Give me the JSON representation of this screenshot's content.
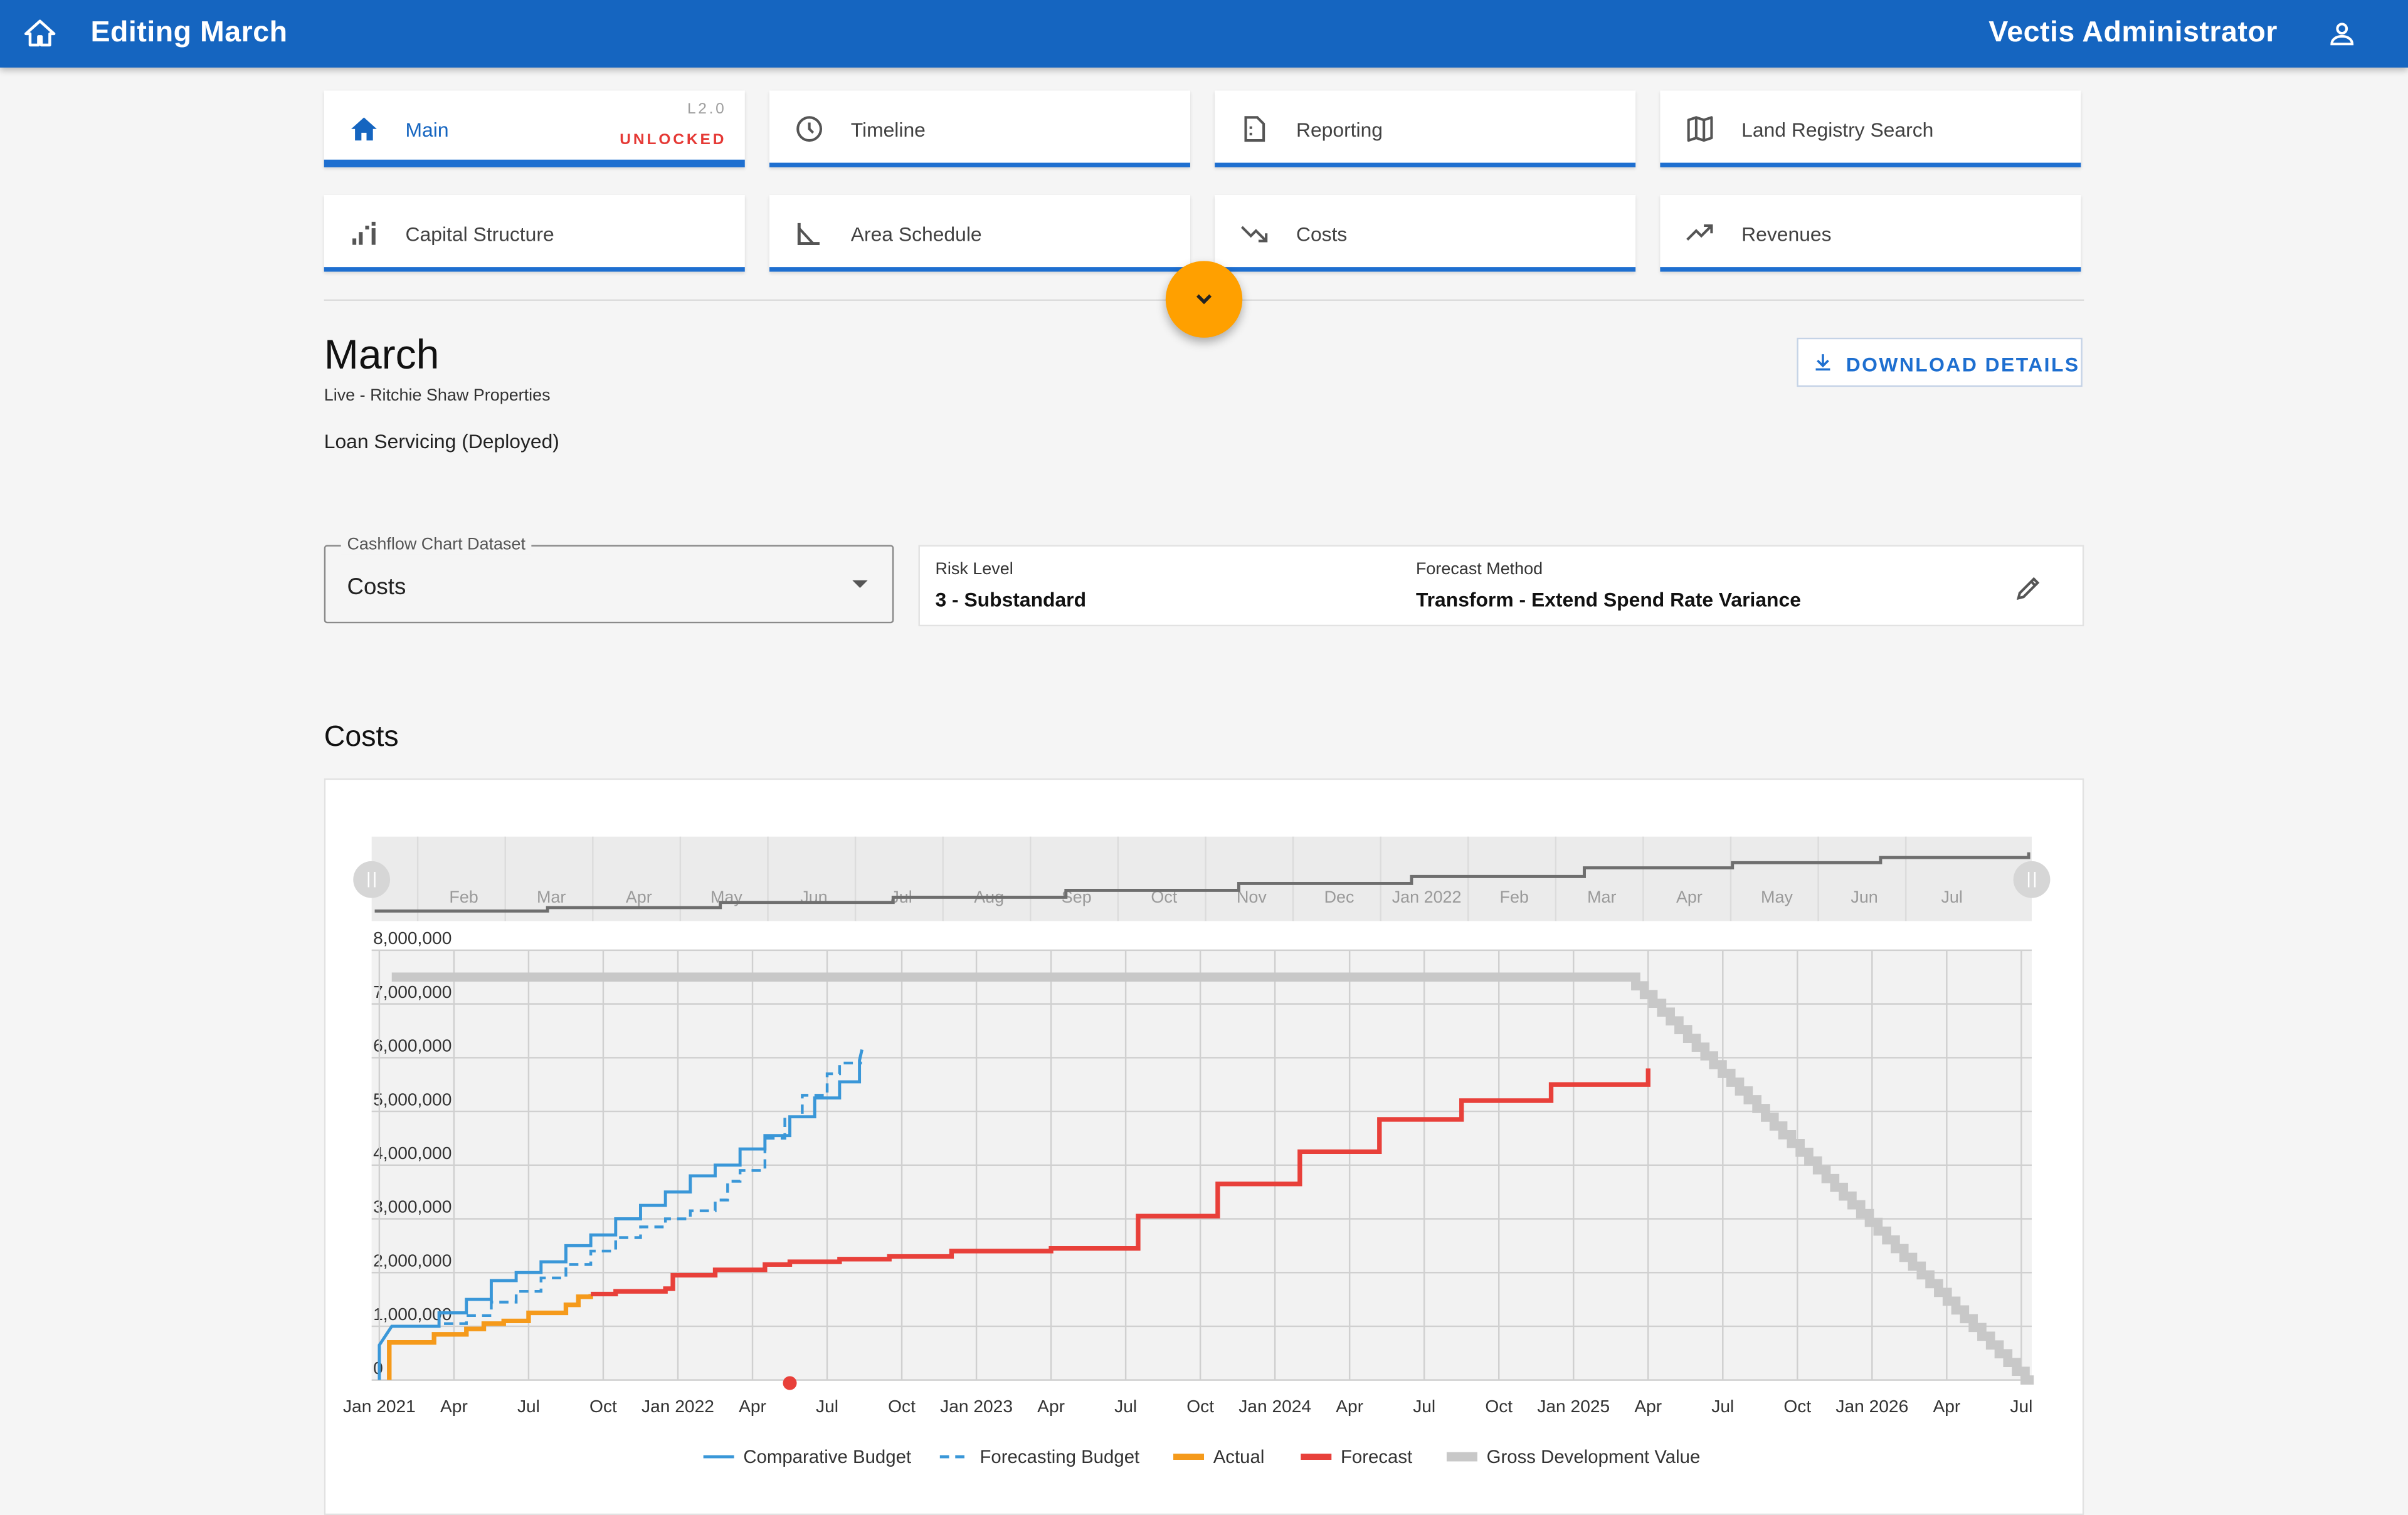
{
  "header": {
    "title": "Editing March",
    "user_name": "Vectis Administrator"
  },
  "nav": {
    "version": "L2.0",
    "status": "UNLOCKED",
    "items": [
      {
        "label": "Main",
        "icon": "home-icon",
        "active": true
      },
      {
        "label": "Timeline",
        "icon": "clock-icon"
      },
      {
        "label": "Reporting",
        "icon": "report-icon"
      },
      {
        "label": "Land Registry Search",
        "icon": "map-icon"
      },
      {
        "label": "Capital Structure",
        "icon": "stairs-icon"
      },
      {
        "label": "Area Schedule",
        "icon": "angle-icon"
      },
      {
        "label": "Costs",
        "icon": "trending-down-icon"
      },
      {
        "label": "Revenues",
        "icon": "trending-up-icon"
      }
    ]
  },
  "project": {
    "name": "March",
    "subtitle": "Live - Ritchie Shaw Properties",
    "state": "Loan Servicing (Deployed)",
    "download_label": "DOWNLOAD DETAILS"
  },
  "dataset_select": {
    "label": "Cashflow Chart Dataset",
    "value": "Costs"
  },
  "risk": {
    "risk_label": "Risk Level",
    "risk_value": "3 - Substandard",
    "method_label": "Forecast Method",
    "method_value": "Transform - Extend Spend Rate Variance"
  },
  "section_title": "Costs",
  "colors": {
    "primary": "#1565c0",
    "accent": "#ffa000",
    "comparative": "#3a97d8",
    "actual": "#f59a1b",
    "forecast": "#e8403a",
    "gdv": "#c8c8c8"
  },
  "chart_data": {
    "type": "line",
    "ylim": [
      0,
      8000000
    ],
    "y_ticks": [
      "0",
      "1,000,000",
      "2,000,000",
      "3,000,000",
      "4,000,000",
      "5,000,000",
      "6,000,000",
      "7,000,000",
      "8,000,000"
    ],
    "x_ticks": [
      "Jan 2021",
      "Apr",
      "Jul",
      "Oct",
      "Jan 2022",
      "Apr",
      "Jul",
      "Oct",
      "Jan 2023",
      "Apr",
      "Jul",
      "Oct",
      "Jan 2024",
      "Apr",
      "Jul",
      "Oct",
      "Jan 2025",
      "Apr",
      "Jul",
      "Oct",
      "Jan 2026",
      "Apr",
      "Jul"
    ],
    "xlim_months": [
      0,
      67
    ],
    "navigator_ticks": [
      "Feb",
      "Mar",
      "Apr",
      "May",
      "Jun",
      "Jul",
      "Aug",
      "Sep",
      "Oct",
      "Nov",
      "Dec",
      "Jan 2022",
      "Feb",
      "Mar",
      "Apr",
      "May",
      "Jun",
      "Jul"
    ],
    "today_marker_month": 16.5,
    "legend": [
      "Comparative Budget",
      "Forecasting Budget",
      "Actual",
      "Forecast",
      "Gross Development Value"
    ],
    "series": [
      {
        "name": "Comparative Budget",
        "style": "solid",
        "points": [
          [
            0,
            0
          ],
          [
            0,
            650000
          ],
          [
            0.5,
            1000000
          ],
          [
            2.4,
            1000000
          ],
          [
            2.4,
            1250000
          ],
          [
            3.5,
            1250000
          ],
          [
            3.5,
            1500000
          ],
          [
            4.5,
            1500000
          ],
          [
            4.5,
            1850000
          ],
          [
            5.5,
            1850000
          ],
          [
            5.5,
            2000000
          ],
          [
            6.5,
            2000000
          ],
          [
            6.5,
            2200000
          ],
          [
            7.5,
            2200000
          ],
          [
            7.5,
            2500000
          ],
          [
            8.5,
            2500000
          ],
          [
            8.5,
            2700000
          ],
          [
            9.5,
            2700000
          ],
          [
            9.5,
            3000000
          ],
          [
            10.5,
            3000000
          ],
          [
            10.5,
            3250000
          ],
          [
            11.5,
            3250000
          ],
          [
            11.5,
            3500000
          ],
          [
            12.5,
            3500000
          ],
          [
            12.5,
            3800000
          ],
          [
            13.5,
            3800000
          ],
          [
            13.5,
            4000000
          ],
          [
            14.5,
            4000000
          ],
          [
            14.5,
            4300000
          ],
          [
            15.5,
            4300000
          ],
          [
            15.5,
            4550000
          ],
          [
            16.5,
            4550000
          ],
          [
            16.5,
            4900000
          ],
          [
            17.5,
            4900000
          ],
          [
            17.5,
            5250000
          ],
          [
            18.5,
            5250000
          ],
          [
            18.5,
            5550000
          ],
          [
            19.3,
            5550000
          ],
          [
            19.3,
            5950000
          ],
          [
            19.4,
            6150000
          ]
        ]
      },
      {
        "name": "Forecasting Budget",
        "style": "dashed",
        "points": [
          [
            2.6,
            1050000
          ],
          [
            3.5,
            1050000
          ],
          [
            3.5,
            1200000
          ],
          [
            4.5,
            1200000
          ],
          [
            4.5,
            1450000
          ],
          [
            5.5,
            1450000
          ],
          [
            5.5,
            1650000
          ],
          [
            6.5,
            1650000
          ],
          [
            6.5,
            1900000
          ],
          [
            7.5,
            1900000
          ],
          [
            7.5,
            2150000
          ],
          [
            8.5,
            2150000
          ],
          [
            8.5,
            2400000
          ],
          [
            9.5,
            2400000
          ],
          [
            9.5,
            2650000
          ],
          [
            10.5,
            2650000
          ],
          [
            10.5,
            2850000
          ],
          [
            11.5,
            2850000
          ],
          [
            11.5,
            3000000
          ],
          [
            12.5,
            3000000
          ],
          [
            12.5,
            3150000
          ],
          [
            13.5,
            3150000
          ],
          [
            13.5,
            3200000
          ],
          [
            13.5,
            3350000
          ],
          [
            14,
            3350000
          ],
          [
            14,
            3700000
          ],
          [
            14.5,
            3700000
          ],
          [
            14.5,
            3900000
          ],
          [
            15.5,
            3900000
          ],
          [
            15.5,
            4500000
          ],
          [
            16.3,
            4500000
          ],
          [
            16.3,
            4900000
          ],
          [
            17,
            4900000
          ],
          [
            17,
            5300000
          ],
          [
            18,
            5300000
          ],
          [
            18,
            5700000
          ],
          [
            18.5,
            5700000
          ],
          [
            18.5,
            5900000
          ],
          [
            19.4,
            5900000
          ]
        ]
      },
      {
        "name": "Actual",
        "style": "solid",
        "points": [
          [
            0.4,
            0
          ],
          [
            0.4,
            700000
          ],
          [
            2.2,
            700000
          ],
          [
            2.2,
            850000
          ],
          [
            3.5,
            850000
          ],
          [
            3.5,
            950000
          ],
          [
            4.2,
            950000
          ],
          [
            4.2,
            1050000
          ],
          [
            5,
            1050000
          ],
          [
            5,
            1100000
          ],
          [
            6,
            1100000
          ],
          [
            6,
            1250000
          ],
          [
            7.5,
            1250000
          ],
          [
            7.5,
            1400000
          ],
          [
            8,
            1400000
          ],
          [
            8,
            1550000
          ],
          [
            8.5,
            1550000
          ],
          [
            8.5,
            1600000
          ]
        ]
      },
      {
        "name": "Forecast",
        "style": "solid",
        "points": [
          [
            8.5,
            1600000
          ],
          [
            9.5,
            1600000
          ],
          [
            9.5,
            1650000
          ],
          [
            11.5,
            1650000
          ],
          [
            11.5,
            1700000
          ],
          [
            11.8,
            1700000
          ],
          [
            11.8,
            1950000
          ],
          [
            13.5,
            1950000
          ],
          [
            13.5,
            2050000
          ],
          [
            15.5,
            2050000
          ],
          [
            15.5,
            2150000
          ],
          [
            16.5,
            2150000
          ],
          [
            16.5,
            2200000
          ],
          [
            18.5,
            2200000
          ],
          [
            18.5,
            2250000
          ],
          [
            20.5,
            2250000
          ],
          [
            20.5,
            2300000
          ],
          [
            23,
            2300000
          ],
          [
            23,
            2400000
          ],
          [
            27,
            2400000
          ],
          [
            27,
            2450000
          ],
          [
            30.5,
            2450000
          ],
          [
            30.5,
            3050000
          ],
          [
            33.7,
            3050000
          ],
          [
            33.7,
            3650000
          ],
          [
            37,
            3650000
          ],
          [
            37,
            4250000
          ],
          [
            40.2,
            4250000
          ],
          [
            40.2,
            4850000
          ],
          [
            43.5,
            4850000
          ],
          [
            43.5,
            5200000
          ],
          [
            47.1,
            5200000
          ],
          [
            47.1,
            5500000
          ],
          [
            51,
            5500000
          ],
          [
            51,
            5800000
          ]
        ]
      },
      {
        "name": "Gross Development Value",
        "style": "step-down",
        "points": [
          [
            0.5,
            7500000
          ],
          [
            50.5,
            7500000
          ],
          [
            66.5,
            0
          ]
        ]
      }
    ],
    "navigator_series": [
      [
        0,
        200000
      ],
      [
        7,
        300000
      ],
      [
        14,
        450000
      ],
      [
        21,
        600000
      ],
      [
        28,
        800000
      ],
      [
        35,
        1000000
      ],
      [
        42,
        1200000
      ],
      [
        49,
        1450000
      ],
      [
        55,
        1600000
      ],
      [
        61,
        1750000
      ],
      [
        67,
        1900000
      ]
    ]
  }
}
